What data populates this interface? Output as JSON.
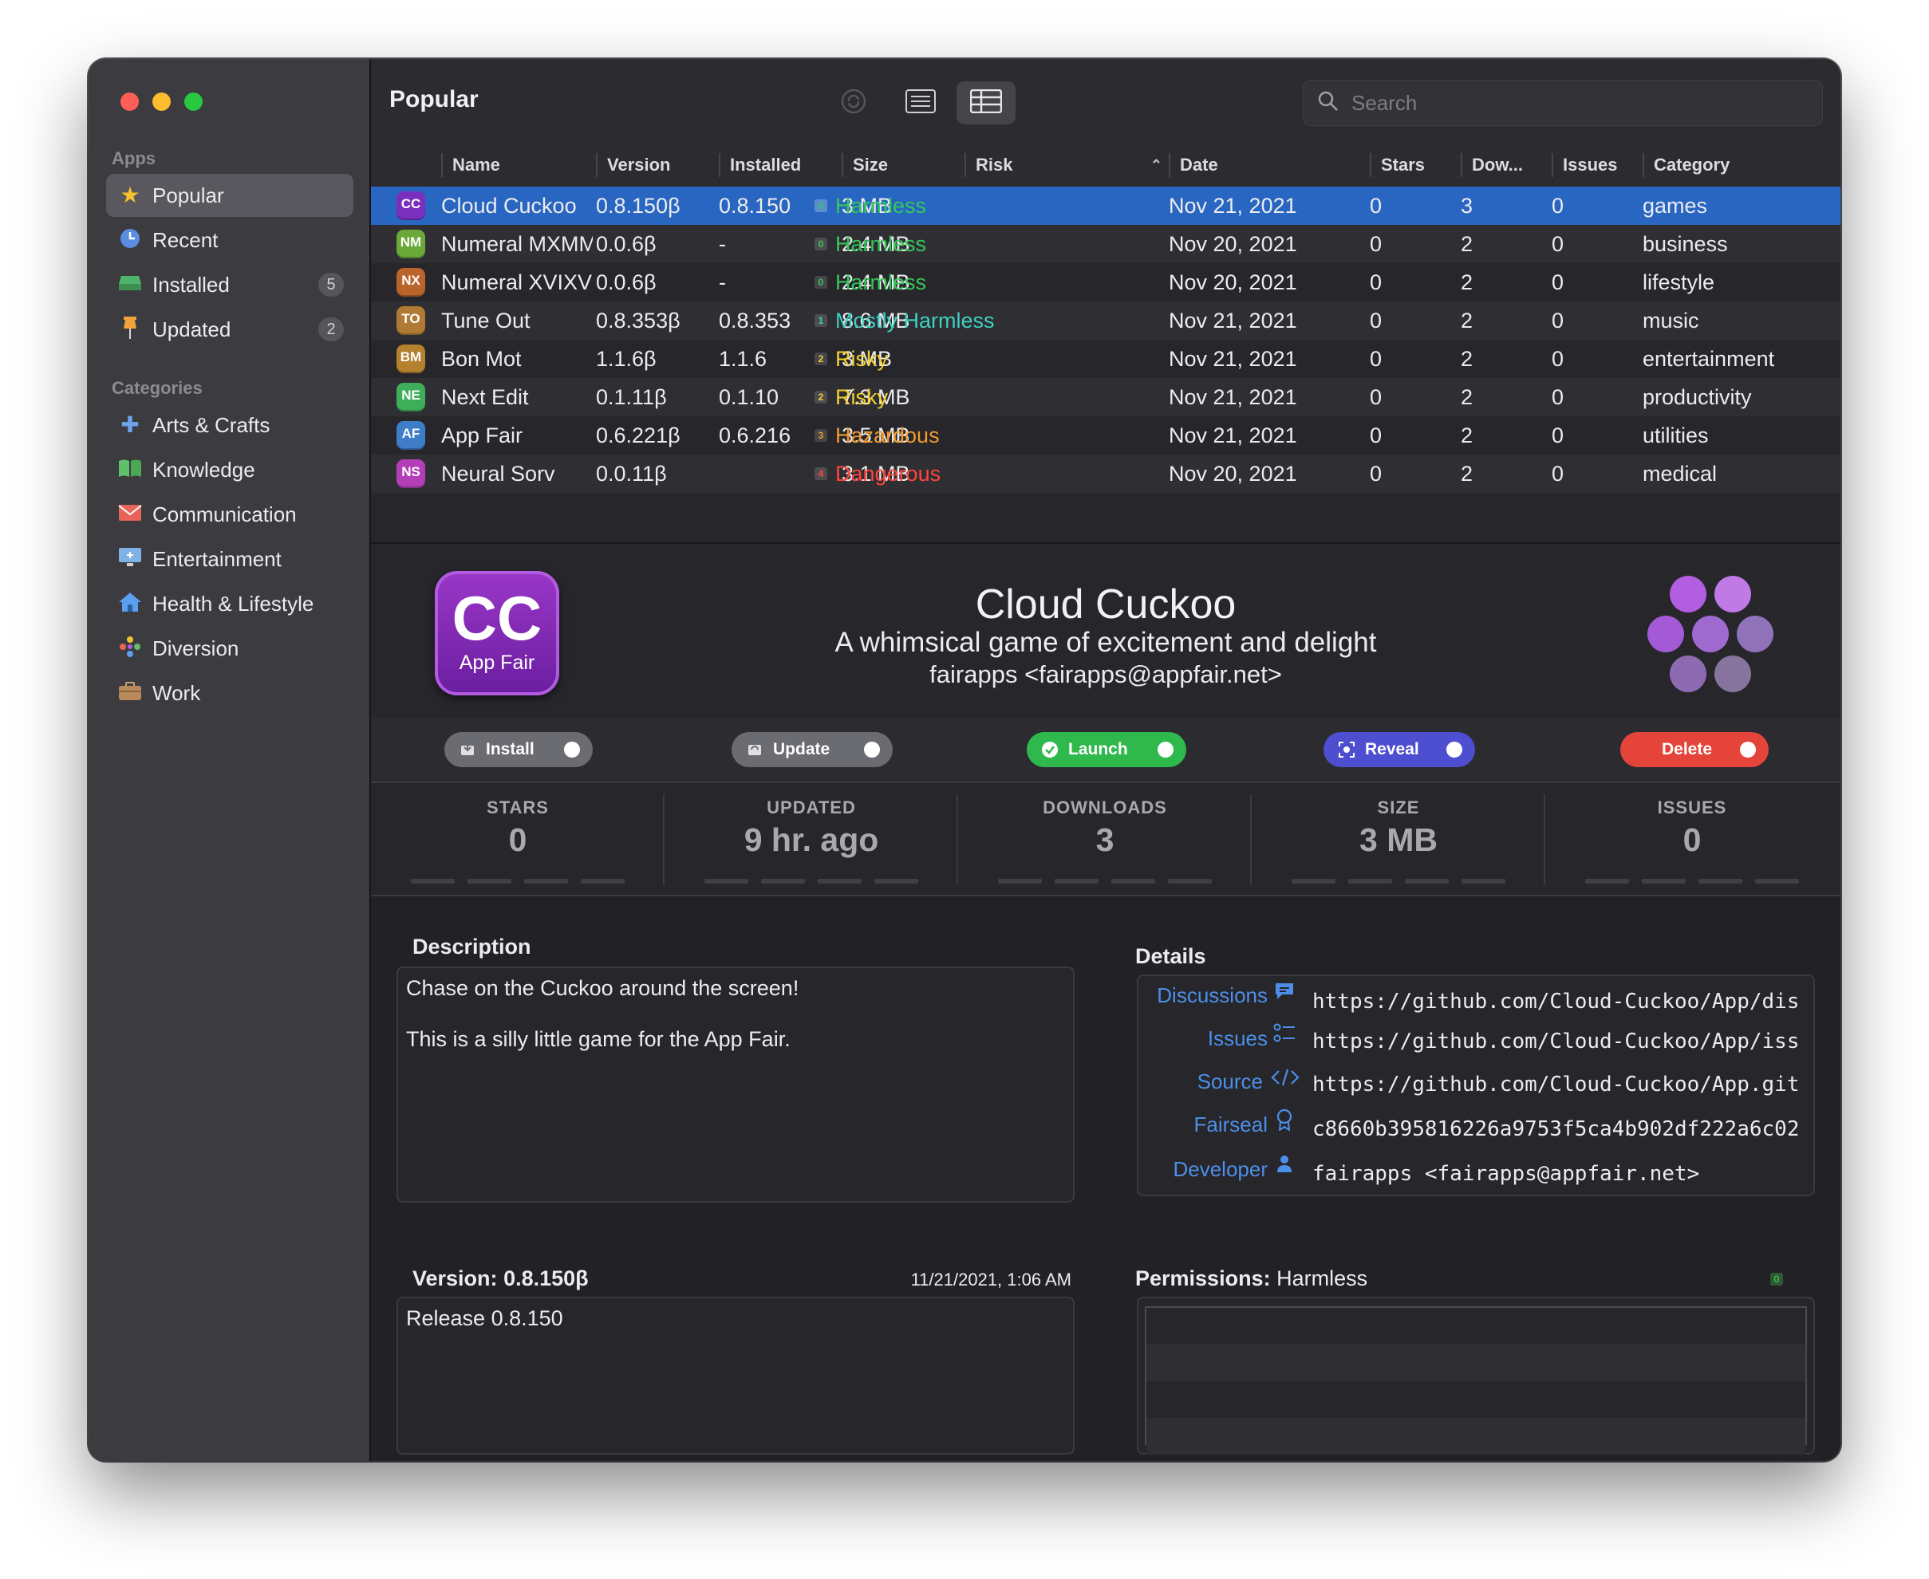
{
  "window": {
    "traffic_lights": {
      "close": "#ff5f57",
      "minimize": "#febc2e",
      "zoom": "#28c840"
    }
  },
  "sidebar": {
    "apps_header": "Apps",
    "apps": [
      {
        "label": "Popular",
        "icon": "star-icon",
        "selected": true,
        "badge": ""
      },
      {
        "label": "Recent",
        "icon": "clock-icon",
        "selected": false,
        "badge": ""
      },
      {
        "label": "Installed",
        "icon": "drive-icon",
        "selected": false,
        "badge": "5"
      },
      {
        "label": "Updated",
        "icon": "pin-icon",
        "selected": false,
        "badge": "2"
      }
    ],
    "categories_header": "Categories",
    "categories": [
      {
        "label": "Arts & Crafts",
        "icon": "puzzle-icon"
      },
      {
        "label": "Knowledge",
        "icon": "book-icon"
      },
      {
        "label": "Communication",
        "icon": "envelope-icon"
      },
      {
        "label": "Entertainment",
        "icon": "screen-icon"
      },
      {
        "label": "Health & Lifestyle",
        "icon": "house-icon"
      },
      {
        "label": "Diversion",
        "icon": "dots-icon"
      },
      {
        "label": "Work",
        "icon": "briefcase-icon"
      }
    ]
  },
  "toolbar": {
    "title": "Popular",
    "search_placeholder": "Search",
    "view_mode": "table"
  },
  "table": {
    "columns": [
      "Name",
      "Version",
      "Installed",
      "Size",
      "Risk",
      "Date",
      "Stars",
      "Dow...",
      "Issues",
      "Category"
    ],
    "sort_column": "Risk",
    "rows": [
      {
        "icon": "CC",
        "icon_color": "#7b2fbf",
        "name": "Cloud Cuckoo",
        "version": "0.8.150β",
        "installed": "0.8.150",
        "size": "3 MB",
        "risk_level": "0",
        "risk": "Harmless",
        "risk_color": "#35c759",
        "date": "Nov 21, 2021",
        "stars": "0",
        "downloads": "3",
        "issues": "0",
        "category": "games",
        "selected": true
      },
      {
        "icon": "NM",
        "icon_color": "#6aa83a",
        "name": "Numeral MXMMXVI",
        "version": "0.0.6β",
        "installed": "-",
        "size": "2.4 MB",
        "risk_level": "0",
        "risk": "Harmless",
        "risk_color": "#35c759",
        "date": "Nov 20, 2021",
        "stars": "0",
        "downloads": "2",
        "issues": "0",
        "category": "business",
        "selected": false
      },
      {
        "icon": "NX",
        "icon_color": "#b8642a",
        "name": "Numeral XVIXVX",
        "version": "0.0.6β",
        "installed": "-",
        "size": "2.4 MB",
        "risk_level": "0",
        "risk": "Harmless",
        "risk_color": "#35c759",
        "date": "Nov 20, 2021",
        "stars": "0",
        "downloads": "2",
        "issues": "0",
        "category": "lifestyle",
        "selected": false
      },
      {
        "icon": "TO",
        "icon_color": "#b07a35",
        "name": "Tune Out",
        "version": "0.8.353β",
        "installed": "0.8.353",
        "size": "8.6 MB",
        "risk_level": "1",
        "risk": "Mostly Harmless",
        "risk_color": "#3fd0c0",
        "date": "Nov 21, 2021",
        "stars": "0",
        "downloads": "2",
        "issues": "0",
        "category": "music",
        "selected": false
      },
      {
        "icon": "BM",
        "icon_color": "#b5812e",
        "name": "Bon Mot",
        "version": "1.1.6β",
        "installed": "1.1.6",
        "size": "3 MB",
        "risk_level": "2",
        "risk": "Risky",
        "risk_color": "#f2d02e",
        "date": "Nov 21, 2021",
        "stars": "0",
        "downloads": "2",
        "issues": "0",
        "category": "entertainment",
        "selected": false
      },
      {
        "icon": "NE",
        "icon_color": "#3fae5a",
        "name": "Next Edit",
        "version": "0.1.11β",
        "installed": "0.1.10",
        "size": "7.3 MB",
        "risk_level": "2",
        "risk": "Risky",
        "risk_color": "#f2d02e",
        "date": "Nov 21, 2021",
        "stars": "0",
        "downloads": "2",
        "issues": "0",
        "category": "productivity",
        "selected": false
      },
      {
        "icon": "AF",
        "icon_color": "#3f7dc9",
        "name": "App Fair",
        "version": "0.6.221β",
        "installed": "0.6.216",
        "size": "3.5 MB",
        "risk_level": "3",
        "risk": "Hazardous",
        "risk_color": "#f29a2e",
        "date": "Nov 21, 2021",
        "stars": "0",
        "downloads": "2",
        "issues": "0",
        "category": "utilities",
        "selected": false
      },
      {
        "icon": "NS",
        "icon_color": "#b23fb8",
        "name": "Neural Sorv",
        "version": "0.0.11β",
        "installed": "",
        "size": "3.1 MB",
        "risk_level": "4",
        "risk": "Dangerous",
        "risk_color": "#ff453a",
        "date": "Nov 20, 2021",
        "stars": "0",
        "downloads": "2",
        "issues": "0",
        "category": "medical",
        "selected": false
      }
    ]
  },
  "detail": {
    "icon_initials": "CC",
    "icon_caption": "App Fair",
    "title": "Cloud Cuckoo",
    "subtitle": "A whimsical game of excitement and delight",
    "developer": "fairapps <fairapps@appfair.net>",
    "actions": [
      {
        "label": "Install",
        "icon": "install-icon",
        "color": "#6b6b72"
      },
      {
        "label": "Update",
        "icon": "update-icon",
        "color": "#6b6b72"
      },
      {
        "label": "Launch",
        "icon": "launch-icon",
        "color": "#2fb84b"
      },
      {
        "label": "Reveal",
        "icon": "reveal-icon",
        "color": "#4e4ed0"
      },
      {
        "label": "Delete",
        "icon": "",
        "color": "#e5443a"
      }
    ],
    "stats": [
      {
        "label": "STARS",
        "value": "0"
      },
      {
        "label": "UPDATED",
        "value": "9 hr. ago"
      },
      {
        "label": "DOWNLOADS",
        "value": "3"
      },
      {
        "label": "SIZE",
        "value": "3 MB"
      },
      {
        "label": "ISSUES",
        "value": "0"
      }
    ],
    "description_title": "Description",
    "description_lines": [
      "Chase on the Cuckoo around the screen!",
      "This is a silly little game for the App Fair."
    ],
    "details_title": "Details",
    "details": [
      {
        "label": "Discussions",
        "icon": "chat-icon",
        "value": "https://github.com/Cloud-Cuckoo/App/dis"
      },
      {
        "label": "Issues",
        "icon": "checklist-icon",
        "value": "https://github.com/Cloud-Cuckoo/App/iss"
      },
      {
        "label": "Source",
        "icon": "code-icon",
        "value": "https://github.com/Cloud-Cuckoo/App.git"
      },
      {
        "label": "Fairseal",
        "icon": "ribbon-icon",
        "value": "c8660b395816226a9753f5ca4b902df222a6c02"
      },
      {
        "label": "Developer",
        "icon": "person-icon",
        "value": "fairapps <fairapps@appfair.net>"
      }
    ],
    "version_title_prefix": "Version:",
    "version_title_value": "0.8.150β",
    "version_date": "11/21/2021, 1:06 AM",
    "release_notes": "Release 0.8.150",
    "permissions_title_prefix": "Permissions:",
    "permissions_title_value": "Harmless",
    "permissions_level": "0"
  },
  "colors": {
    "accent_selection": "#2866c2",
    "link_blue": "#4d8fe8",
    "dots": "#b15ee0"
  }
}
